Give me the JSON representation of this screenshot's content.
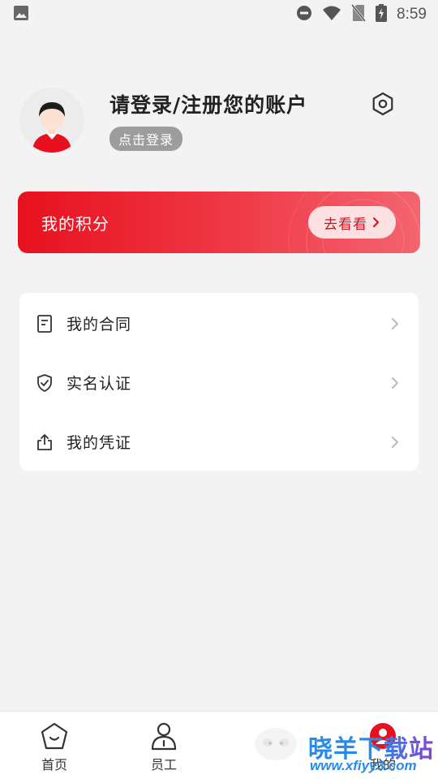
{
  "status_bar": {
    "time": "8:59",
    "icons": [
      "image-icon",
      "dnd-icon",
      "wifi-icon",
      "no-sim-icon",
      "battery-charging-icon"
    ]
  },
  "profile": {
    "title": "请登录/注册您的账户",
    "login_chip": "点击登录",
    "settings_icon": "settings-hex-icon"
  },
  "points_banner": {
    "label": "我的积分",
    "button_label": "去看看",
    "accent": "#e8101e"
  },
  "menu": {
    "items": [
      {
        "label": "我的合同",
        "icon": "document-icon"
      },
      {
        "label": "实名认证",
        "icon": "shield-check-icon"
      },
      {
        "label": "我的凭证",
        "icon": "share-upload-icon"
      }
    ]
  },
  "bottom_nav": {
    "items": [
      {
        "label": "首页",
        "icon": "home-icon",
        "active": false
      },
      {
        "label": "员工",
        "icon": "employee-icon",
        "active": false
      },
      {
        "label": "",
        "icon": "sheep-mascot-icon",
        "active": false
      },
      {
        "label": "我的",
        "icon": "mine-icon",
        "active": true
      }
    ]
  },
  "watermark": {
    "brand": "晓羊下载站",
    "url": "www.xfiyy3.com"
  }
}
